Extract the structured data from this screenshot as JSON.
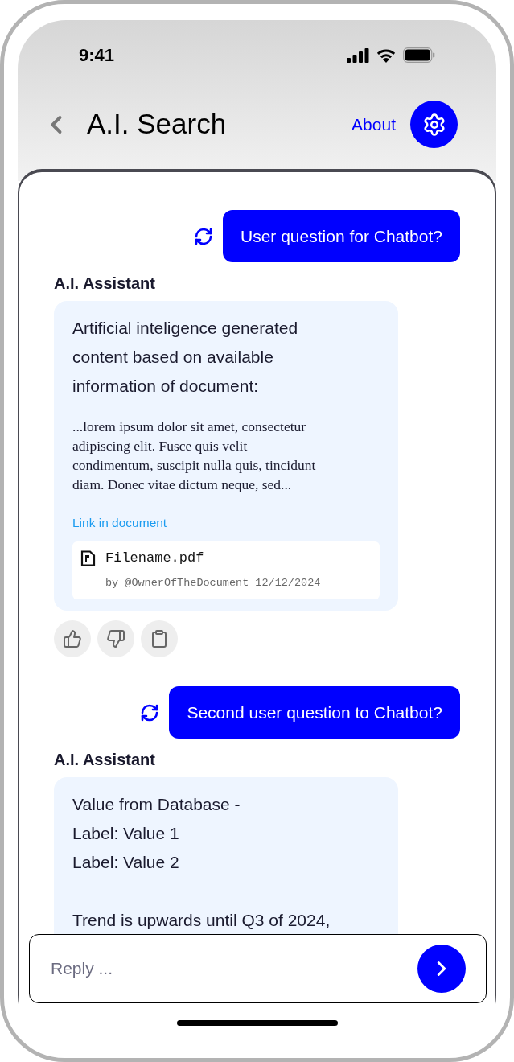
{
  "status_bar": {
    "time": "9:41"
  },
  "header": {
    "title": "A.I. Search",
    "about_link": "About"
  },
  "messages": [
    {
      "kind": "user",
      "text": "User question for Chatbot?"
    },
    {
      "kind": "assistant",
      "sender": "A.I. Assistant",
      "actions_shown": true,
      "blocks": [
        {
          "kind": "text",
          "lines": [
            "Artificial inteligence generated",
            "content based on available",
            "information of document:"
          ]
        },
        {
          "kind": "excerpt",
          "lines": [
            "...lorem ipsum dolor sit amet, consectetur",
            "adipiscing elit. Fusce quis velit",
            "condimentum, suscipit nulla quis, tincidunt",
            "diam. Donec vitae dictum neque, sed..."
          ]
        },
        {
          "kind": "link",
          "text": "Link in document"
        },
        {
          "kind": "file",
          "name": "Filename.pdf",
          "meta": "by @OwnerOfTheDocument 12/12/2024"
        }
      ]
    },
    {
      "kind": "user",
      "text": "Second user question to Chatbot?"
    },
    {
      "kind": "assistant",
      "sender": "A.I. Assistant",
      "actions_shown": false,
      "blocks": [
        {
          "kind": "text",
          "lines": [
            "Value from Database -",
            "Label: Value 1",
            "Label: Value 2"
          ]
        },
        {
          "kind": "text",
          "lines": [
            "Trend is upwards until Q3 of 2024,"
          ]
        }
      ]
    }
  ],
  "reply": {
    "placeholder": "Reply ..."
  }
}
